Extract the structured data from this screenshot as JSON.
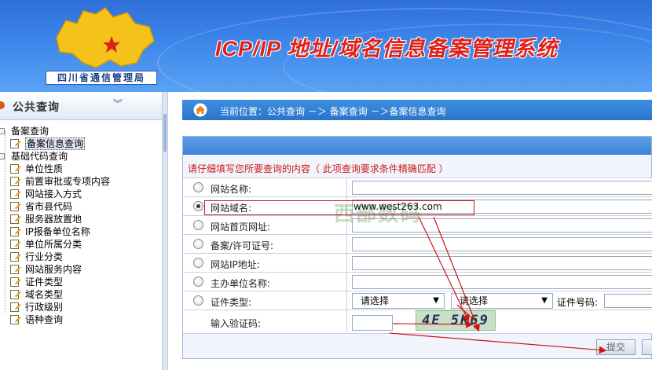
{
  "header": {
    "logo_caption": "四川省通信管理局",
    "system_title": "ICP/IP 地址/域名信息备案管理系统"
  },
  "sidebar": {
    "title": "公共查询",
    "groups": [
      {
        "label": "备案查询",
        "items": [
          {
            "label": "备案信息查询",
            "selected": true
          }
        ]
      },
      {
        "label": "基础代码查询",
        "items": [
          {
            "label": "单位性质"
          },
          {
            "label": "前置审批或专项内容"
          },
          {
            "label": "网站接入方式"
          },
          {
            "label": "省市县代码"
          },
          {
            "label": "服务器放置地"
          },
          {
            "label": "IP报备单位名称"
          },
          {
            "label": "单位所属分类"
          },
          {
            "label": "行业分类"
          },
          {
            "label": "网站服务内容"
          },
          {
            "label": "证件类型"
          },
          {
            "label": "域名类型"
          },
          {
            "label": "行政级别"
          },
          {
            "label": "语种查询"
          }
        ]
      }
    ]
  },
  "breadcrumb": {
    "text": "当前位置：公共查询   －＞   备案查询   －＞备案信息查询"
  },
  "form": {
    "notice": "请仔细填写您所要查询的内容（ 此项查询要求条件精确匹配 ）",
    "fields": [
      {
        "label": "网站名称:",
        "value": "",
        "checked": false
      },
      {
        "label": "网站域名:",
        "value": "www.west263.com",
        "checked": true
      },
      {
        "label": "网站首页网址:",
        "value": "",
        "checked": false
      },
      {
        "label": "备案/许可证号:",
        "value": "",
        "checked": false
      },
      {
        "label": "网站IP地址:",
        "value": "",
        "checked": false
      },
      {
        "label": "主办单位名称:",
        "value": "",
        "checked": false
      }
    ],
    "cert": {
      "label": "证件类型:",
      "select1": "请选择",
      "select2": "请选择",
      "certno_label": "证件号码:"
    },
    "captcha": {
      "label": "输入验证码:",
      "code": "4E 5K69"
    },
    "submit_label": "提交"
  },
  "watermark": "西部数码",
  "colors": {
    "header_blue": "#3c86ea",
    "title_red": "#e0201a",
    "annotation_red": "#d01515"
  }
}
